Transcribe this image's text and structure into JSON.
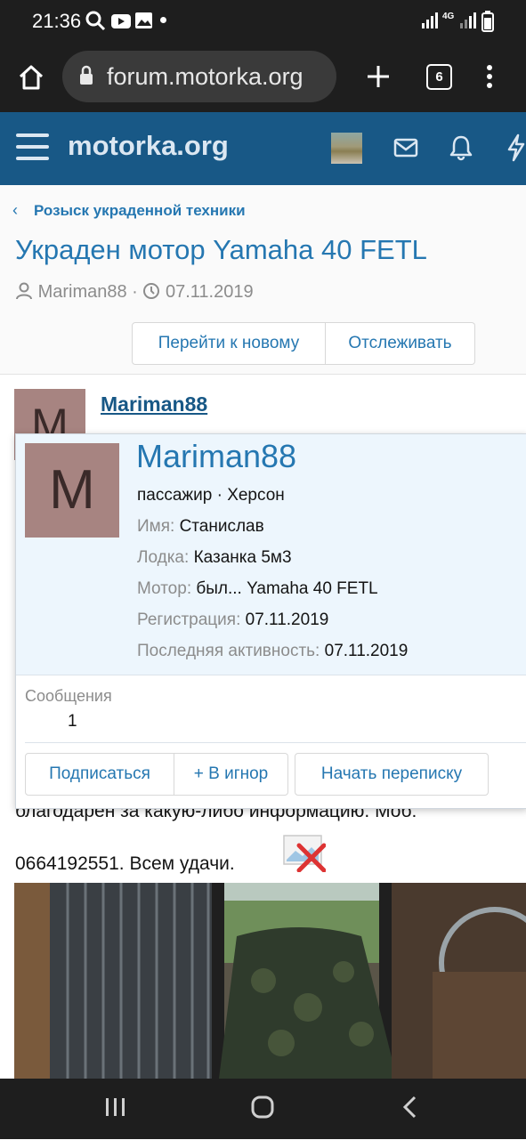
{
  "status_bar": {
    "time": "21:36",
    "network": "4G"
  },
  "browser": {
    "url": "forum.motorka.org",
    "tab_count": "6"
  },
  "site": {
    "logo": "motorka.org"
  },
  "breadcrumb": {
    "label": "Розыск украденной техники"
  },
  "thread": {
    "title": "Украден мотор Yamaha 40 FETL",
    "author": "Mariman88",
    "separator": "·",
    "date": "07.11.2019",
    "btn_unread": "Перейти к новому",
    "btn_watch": "Отслеживать"
  },
  "post": {
    "avatar_letter": "M",
    "username": "Mariman88",
    "line1": "благодарен за какую-либо информацию. Моб:",
    "line2": "0664192551. Всем удачи."
  },
  "member_card": {
    "avatar_letter": "M",
    "name": "Mariman88",
    "title_location": "пассажир · Херсон",
    "name_label": "Имя:",
    "name_value": "Станислав",
    "boat_label": "Лодка:",
    "boat_value": "Казанка 5м3",
    "motor_label": "Мотор:",
    "motor_value": "был... Yamaha 40 FETL",
    "reg_label": "Регистрация:",
    "reg_value": "07.11.2019",
    "activity_label": "Последняя активность:",
    "activity_value": "07.11.2019",
    "messages_label": "Сообщения",
    "messages_value": "1",
    "btn_follow": "Подписаться",
    "btn_ignore": "+ В игнор",
    "btn_message": "Начать переписку"
  },
  "colors": {
    "header": "#185886",
    "link": "#2577b1",
    "avatar": "#a78481"
  }
}
